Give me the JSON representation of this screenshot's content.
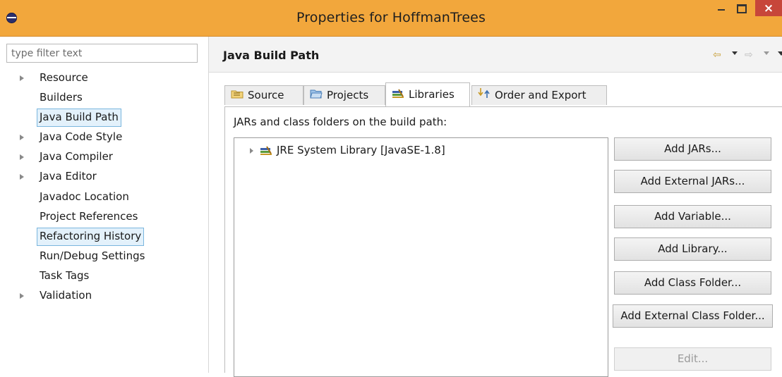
{
  "window": {
    "title": "Properties for HoffmanTrees",
    "close_glyph": "×"
  },
  "left": {
    "filter_placeholder": "type filter text",
    "tree": [
      {
        "label": "Resource",
        "expandable": true,
        "selected": false
      },
      {
        "label": "Builders",
        "expandable": false,
        "selected": false
      },
      {
        "label": "Java Build Path",
        "expandable": false,
        "selected": true
      },
      {
        "label": "Java Code Style",
        "expandable": true,
        "selected": false
      },
      {
        "label": "Java Compiler",
        "expandable": true,
        "selected": false
      },
      {
        "label": "Java Editor",
        "expandable": true,
        "selected": false
      },
      {
        "label": "Javadoc Location",
        "expandable": false,
        "selected": false
      },
      {
        "label": "Project References",
        "expandable": false,
        "selected": false
      },
      {
        "label": "Refactoring History",
        "expandable": false,
        "selected": true
      },
      {
        "label": "Run/Debug Settings",
        "expandable": false,
        "selected": false
      },
      {
        "label": "Task Tags",
        "expandable": false,
        "selected": false
      },
      {
        "label": "Validation",
        "expandable": true,
        "selected": false
      }
    ]
  },
  "header": {
    "title": "Java Build Path",
    "back_glyph": "⇦",
    "forward_glyph": "⇨"
  },
  "tabs": [
    {
      "label": "Source",
      "icon": "source-folder-icon"
    },
    {
      "label": "Projects",
      "icon": "projects-folder-icon"
    },
    {
      "label": "Libraries",
      "icon": "libraries-icon",
      "active": true
    },
    {
      "label": "Order and Export",
      "icon": "order-export-icon"
    }
  ],
  "panel": {
    "label": "JARs and class folders on the build path:",
    "entries": [
      {
        "label": "JRE System Library [JavaSE-1.8]",
        "icon": "library-icon"
      }
    ]
  },
  "buttons": [
    {
      "label": "Add JARs...",
      "enabled": true
    },
    {
      "label": "Add External JARs...",
      "enabled": true
    },
    {
      "label": "Add Variable...",
      "enabled": true
    },
    {
      "label": "Add Library...",
      "enabled": true
    },
    {
      "label": "Add Class Folder...",
      "enabled": true
    },
    {
      "label": "Add External Class Folder...",
      "enabled": true
    },
    {
      "label": "Edit...",
      "enabled": false
    }
  ],
  "colors": {
    "titlebar": "#f2a73c",
    "close_button": "#c7463a",
    "selection_fill": "#e3f1fb",
    "selection_border": "#7ab6de"
  }
}
